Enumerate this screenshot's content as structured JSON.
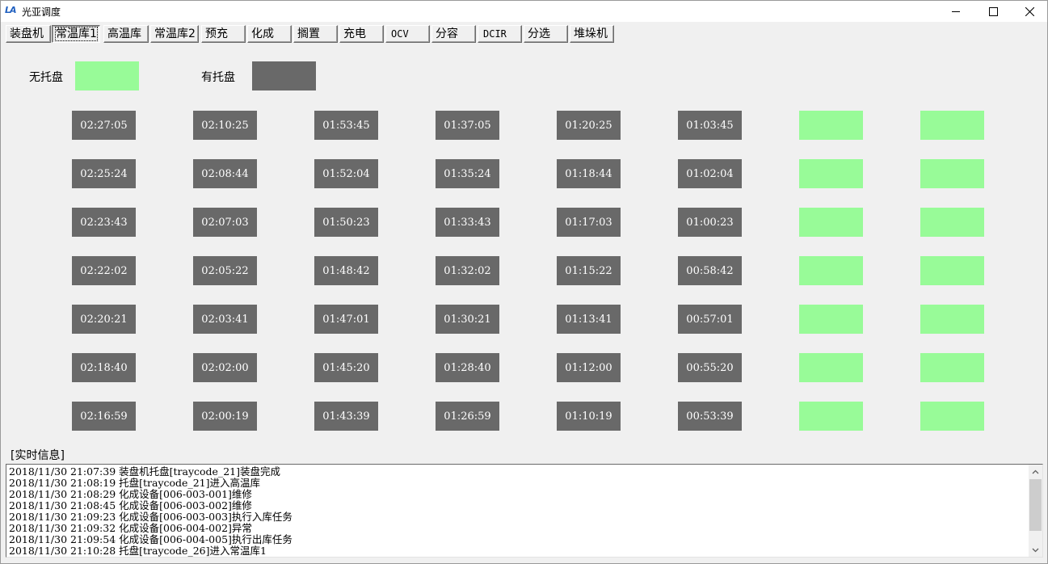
{
  "window": {
    "logo": "LA",
    "title": "光亚调度",
    "controls": [
      "minimize",
      "maximize",
      "close"
    ]
  },
  "tabs": [
    {
      "label": "装盘机",
      "active": false
    },
    {
      "label": "常温库1",
      "active": true
    },
    {
      "label": "高温库",
      "active": false
    },
    {
      "label": "常温库2",
      "active": false
    },
    {
      "label": "预充",
      "active": false
    },
    {
      "label": "化成",
      "active": false
    },
    {
      "label": "搁置",
      "active": false
    },
    {
      "label": "充电",
      "active": false
    },
    {
      "label": "OCV",
      "active": false
    },
    {
      "label": "分容",
      "active": false
    },
    {
      "label": "DCIR",
      "active": false
    },
    {
      "label": "分选",
      "active": false
    },
    {
      "label": "堆垛机",
      "active": false
    }
  ],
  "legend": {
    "empty_label": "无托盘",
    "empty_color": "#98fb98",
    "occupied_label": "有托盘",
    "occupied_color": "#696969"
  },
  "grid": {
    "rows": [
      [
        "02:27:05",
        "02:10:25",
        "01:53:45",
        "01:37:05",
        "01:20:25",
        "01:03:45",
        "",
        ""
      ],
      [
        "02:25:24",
        "02:08:44",
        "01:52:04",
        "01:35:24",
        "01:18:44",
        "01:02:04",
        "",
        ""
      ],
      [
        "02:23:43",
        "02:07:03",
        "01:50:23",
        "01:33:43",
        "01:17:03",
        "01:00:23",
        "",
        ""
      ],
      [
        "02:22:02",
        "02:05:22",
        "01:48:42",
        "01:32:02",
        "01:15:22",
        "00:58:42",
        "",
        ""
      ],
      [
        "02:20:21",
        "02:03:41",
        "01:47:01",
        "01:30:21",
        "01:13:41",
        "00:57:01",
        "",
        ""
      ],
      [
        "02:18:40",
        "02:02:00",
        "01:45:20",
        "01:28:40",
        "01:12:00",
        "00:55:20",
        "",
        ""
      ],
      [
        "02:16:59",
        "02:00:19",
        "01:43:39",
        "01:26:59",
        "01:10:19",
        "00:53:39",
        "",
        ""
      ]
    ]
  },
  "info": {
    "caption": "[实时信息]",
    "lines": [
      "2018/11/30 21:07:39 装盘机托盘[traycode_21]装盘完成",
      "2018/11/30 21:08:19 托盘[traycode_21]进入高温库",
      "2018/11/30 21:08:29 化成设备[006-003-001]维修",
      "2018/11/30 21:08:45 化成设备[006-003-002]维修",
      "2018/11/30 21:09:23 化成设备[006-003-003]执行入库任务",
      "2018/11/30 21:09:32 化成设备[006-004-002]异常",
      "2018/11/30 21:09:54 化成设备[006-004-005]执行出库任务",
      "2018/11/30 21:10:28 托盘[traycode_26]进入常温库1"
    ]
  }
}
